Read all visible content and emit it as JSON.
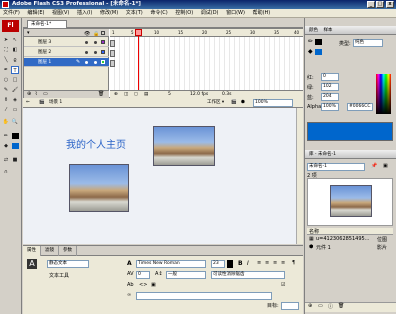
{
  "window": {
    "title": "Adobe Flash CS3 Professional - [未命名-1*]",
    "min": "_",
    "max": "□",
    "close": "x"
  },
  "menu": [
    "文件(F)",
    "编辑(E)",
    "视图(V)",
    "插入(I)",
    "修改(M)",
    "文本(T)",
    "命令(C)",
    "控制(O)",
    "调试(D)",
    "窗口(W)",
    "帮助(H)"
  ],
  "document": {
    "tab": "未命名-1*"
  },
  "timeline": {
    "layers": [
      {
        "name": "图层 3"
      },
      {
        "name": "图层 2"
      },
      {
        "name": "图层 1"
      }
    ],
    "ruler": [
      "1",
      "5",
      "10",
      "15",
      "20",
      "25",
      "30",
      "35",
      "40",
      "45",
      "50"
    ],
    "status": {
      "frame": "5",
      "fps": "12.0 fps",
      "time": "0.3s"
    }
  },
  "editbar": {
    "scene": "场景 1",
    "workspace": "工作区 ▾",
    "zoom": "100%"
  },
  "stage": {
    "heading": "我的个人主页"
  },
  "properties": {
    "tabs": [
      "属性",
      "滤镜",
      "参数"
    ],
    "text_type": "静态文本",
    "tool_name": "文本工具",
    "font": "Times New Roman",
    "size": "23",
    "spacing": "0",
    "kerning": "一般",
    "antialias": "可读性消除锯齿",
    "target": "目标:",
    "bold": "B",
    "italic": "I"
  },
  "colorpanel": {
    "tabs": [
      "颜色",
      "样本"
    ],
    "type_label": "类型:",
    "type": "纯色",
    "r_label": "红:",
    "r": "0",
    "g_label": "绿:",
    "g": "102",
    "b_label": "蓝:",
    "b": "204",
    "alpha_label": "Alpha:",
    "alpha": "100%",
    "hex": "#0066CC",
    "color": "#0066cc"
  },
  "library": {
    "title": "库 - 未命名-1",
    "doc": "未命名-1",
    "count": "2 项",
    "col_name": "名称",
    "items": [
      {
        "name": "u=4123062851495...",
        "type": "位图"
      },
      {
        "name": "元件 1",
        "type": "影片"
      }
    ]
  }
}
